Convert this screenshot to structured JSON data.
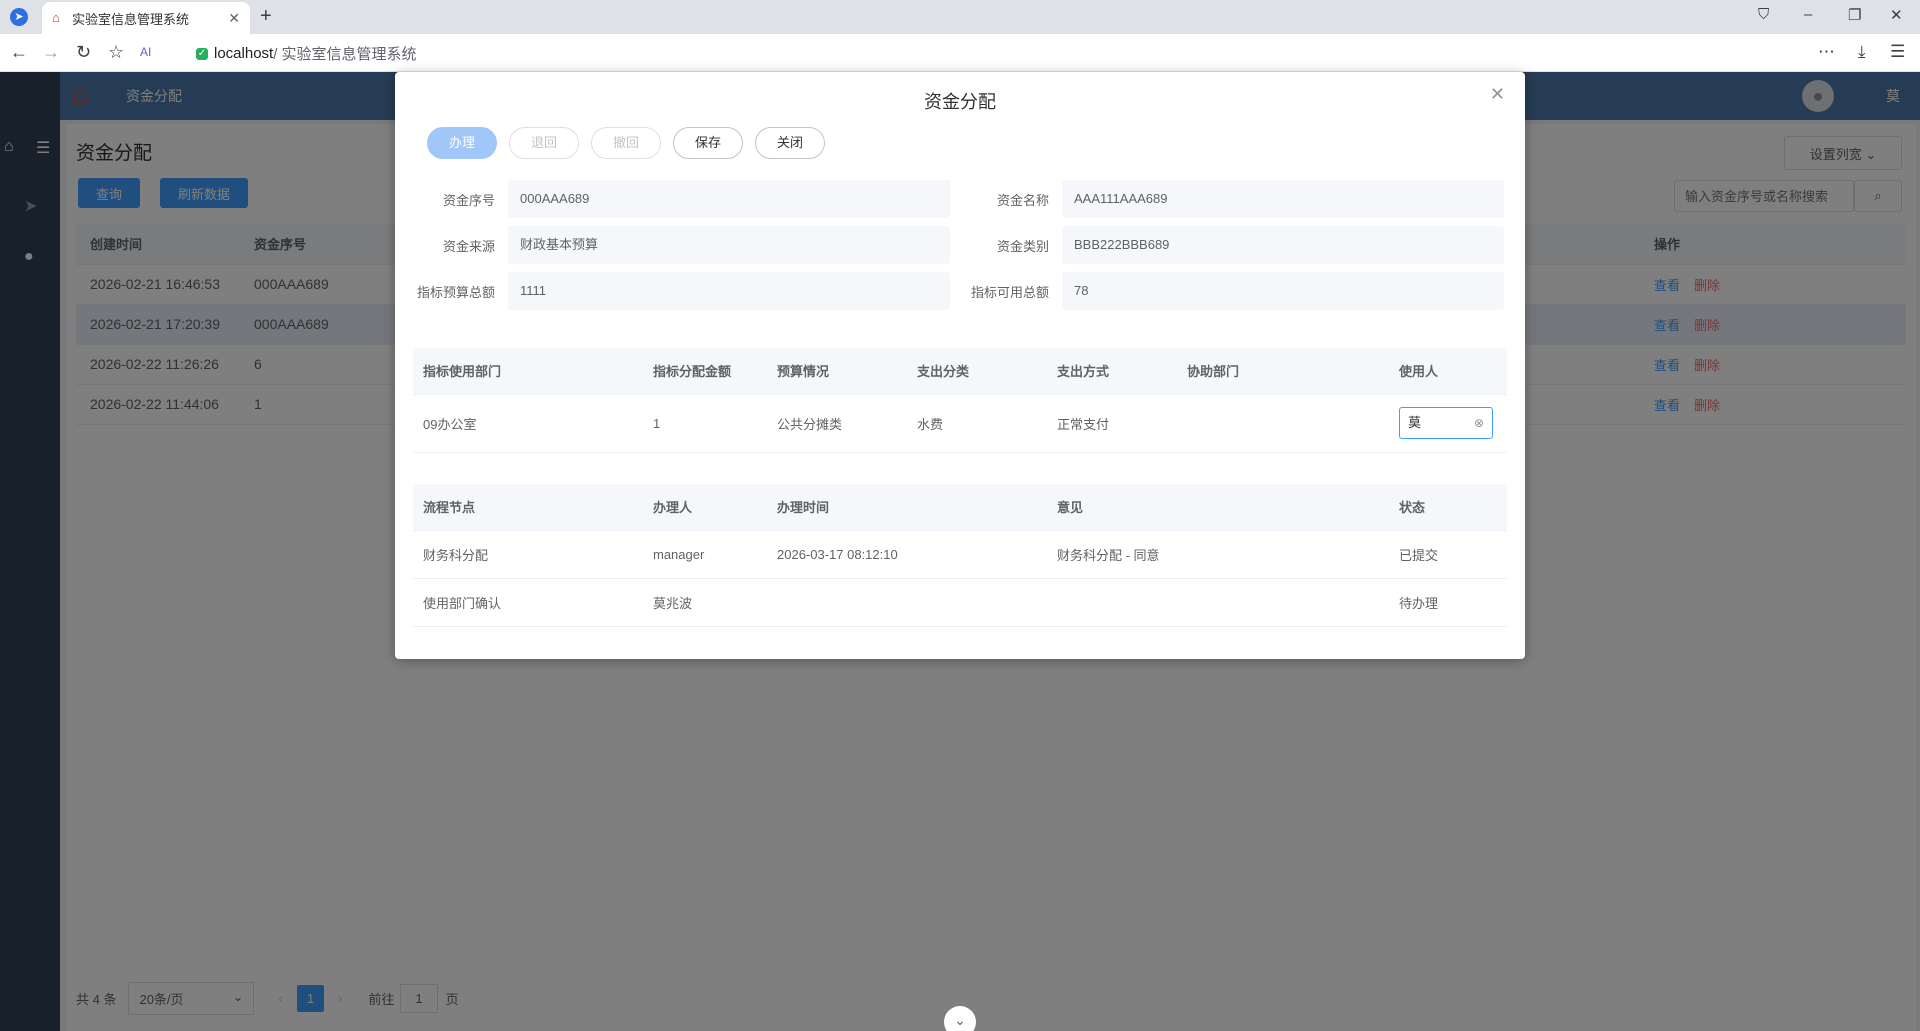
{
  "browser": {
    "tab_title": "实验室信息管理系统",
    "url_host": "localhost",
    "url_path": " / 实验室信息管理系统"
  },
  "header": {
    "breadcrumb": "资金分配",
    "user_name": "莫"
  },
  "page": {
    "title": "资金分配",
    "query_label": "查询",
    "refresh_label": "刷新数据",
    "set_columns_label": "设置列宽",
    "search_placeholder": "输入资金序号或名称搜索"
  },
  "main_table": {
    "columns": {
      "created": "创建时间",
      "serial": "资金序号",
      "actions": "操作"
    },
    "rows": [
      {
        "created": "2026-02-21 16:46:53",
        "serial": "000AAA689"
      },
      {
        "created": "2026-02-21 17:20:39",
        "serial": "000AAA689"
      },
      {
        "created": "2026-02-22 11:26:26",
        "serial": "6"
      },
      {
        "created": "2026-02-22 11:44:06",
        "serial": "1"
      }
    ],
    "view_label": "查看",
    "delete_label": "删除"
  },
  "pager": {
    "total": "共 4 条",
    "page_size": "20条/页",
    "current": "1",
    "goto_label": "前往",
    "goto_value": "1",
    "page_suffix": "页"
  },
  "modal": {
    "title": "资金分配",
    "buttons": {
      "handle": "办理",
      "return": "退回",
      "withdraw": "撤回",
      "save": "保存",
      "close": "关闭"
    },
    "form": {
      "serial_label": "资金序号",
      "serial_value": "000AAA689",
      "name_label": "资金名称",
      "name_value": "AAA111AAA689",
      "source_label": "资金来源",
      "source_value": "财政基本预算",
      "category_label": "资金类别",
      "category_value": "BBB222BBB689",
      "budget_total_label": "指标预算总额",
      "budget_total_value": "1111",
      "available_total_label": "指标可用总额",
      "available_total_value": "78"
    },
    "alloc_table": {
      "columns": [
        "指标使用部门",
        "指标分配金额",
        "预算情况",
        "支出分类",
        "支出方式",
        "协助部门",
        "使用人"
      ],
      "row": {
        "dept": "09办公室",
        "amount": "1",
        "budget": "公共分摊类",
        "expense_category": "水费",
        "payment_method": "正常支付",
        "assist_dept": "",
        "user": "莫"
      }
    },
    "flow_table": {
      "columns": [
        "流程节点",
        "办理人",
        "办理时间",
        "意见",
        "状态"
      ],
      "rows": [
        {
          "node": "财务科分配",
          "handler": "manager",
          "time": "2026-03-17 08:12:10",
          "opinion": "财务科分配 - 同意",
          "status": "已提交"
        },
        {
          "node": "使用部门确认",
          "handler": "莫兆波",
          "time": "",
          "opinion": "",
          "status": "待办理"
        }
      ]
    }
  }
}
